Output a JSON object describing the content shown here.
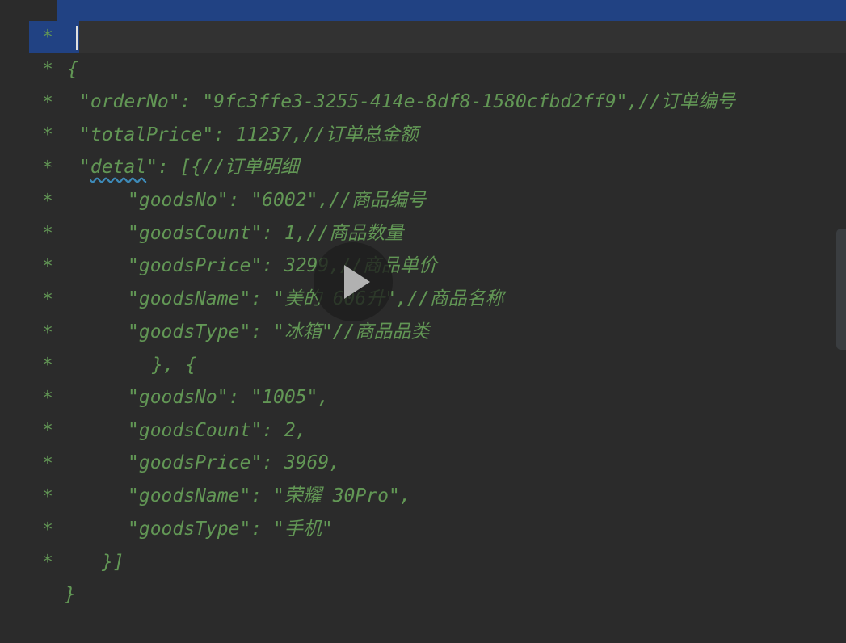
{
  "gutter": {
    "star": "*"
  },
  "lines": [
    {
      "code": "{"
    },
    {
      "code": "\"orderNo\": \"9fc3ffe3-3255-414e-8df8-1580cfbd2ff9\",//订单编号"
    },
    {
      "code": "\"totalPrice\": 11237,//订单总金额"
    },
    {
      "code_pre": "\"",
      "code_word": "detal",
      "code_post": "\": [{//订单明细"
    },
    {
      "code": "\"goodsNo\": \"6002\",//商品编号"
    },
    {
      "code": "\"goodsCount\": 1,//商品数量"
    },
    {
      "code": "\"goodsPrice\": 3299,//商品单价"
    },
    {
      "code": "\"goodsName\": \"美的 606升\",//商品名称"
    },
    {
      "code": "\"goodsType\": \"冰箱\"//商品品类"
    },
    {
      "code": "}, {"
    },
    {
      "code": "\"goodsNo\": \"1005\","
    },
    {
      "code": "\"goodsCount\": 2,"
    },
    {
      "code": "\"goodsPrice\": 3969,"
    },
    {
      "code": "\"goodsName\": \"荣耀 30Pro\","
    },
    {
      "code": "\"goodsType\": \"手机\""
    },
    {
      "code": "}]"
    },
    {
      "code": "}"
    }
  ],
  "colors": {
    "background": "#2b2b2b",
    "doc_comment_text": "#629755",
    "selection": "#214283",
    "current_line": "#323232",
    "caret": "#e0e0e0"
  },
  "icons": {
    "play": "play-icon"
  }
}
